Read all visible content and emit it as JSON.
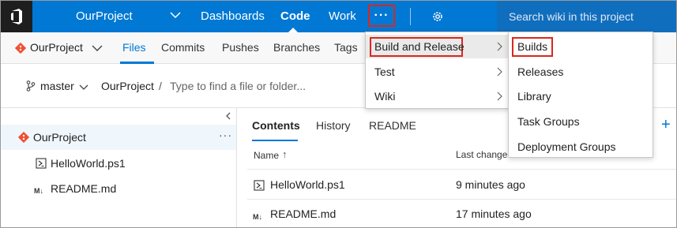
{
  "topbar": {
    "project": "OurProject",
    "nav": [
      "Dashboards",
      "Code",
      "Work"
    ],
    "active_nav": "Code",
    "more_label": "···",
    "search_placeholder": "Search wiki in this project"
  },
  "subbar": {
    "repo": "OurProject",
    "tabs": [
      "Files",
      "Commits",
      "Pushes",
      "Branches",
      "Tags"
    ],
    "active_tab": "Files"
  },
  "branchrow": {
    "branch": "master",
    "crumb": "OurProject",
    "slash": "/",
    "path_placeholder": "Type to find a file or folder..."
  },
  "tree": {
    "root": "OurProject",
    "root_more": "···",
    "files": [
      {
        "name": "HelloWorld.ps1",
        "icon": "powershell-file-icon"
      },
      {
        "name": "README.md",
        "icon": "markdown-file-icon"
      }
    ]
  },
  "content": {
    "tabs": [
      "Contents",
      "History",
      "README"
    ],
    "active_tab": "Contents",
    "columns": {
      "name": "Name",
      "sort_arrow": "↑",
      "last_change": "Last change"
    },
    "rows": [
      {
        "name": "HelloWorld.ps1",
        "time": "9 minutes ago"
      },
      {
        "name": "README.md",
        "time": "17 minutes ago"
      }
    ]
  },
  "menu_more": {
    "items": [
      "Build and Release",
      "Test",
      "Wiki"
    ],
    "highlighted": "Build and Release"
  },
  "menu_build": {
    "items": [
      "Builds",
      "Releases",
      "Library",
      "Task Groups",
      "Deployment Groups"
    ],
    "highlighted": "Builds"
  },
  "colors": {
    "accent": "#0078d4",
    "highlight_box": "#d9281e",
    "git_orange": "#f05033"
  }
}
